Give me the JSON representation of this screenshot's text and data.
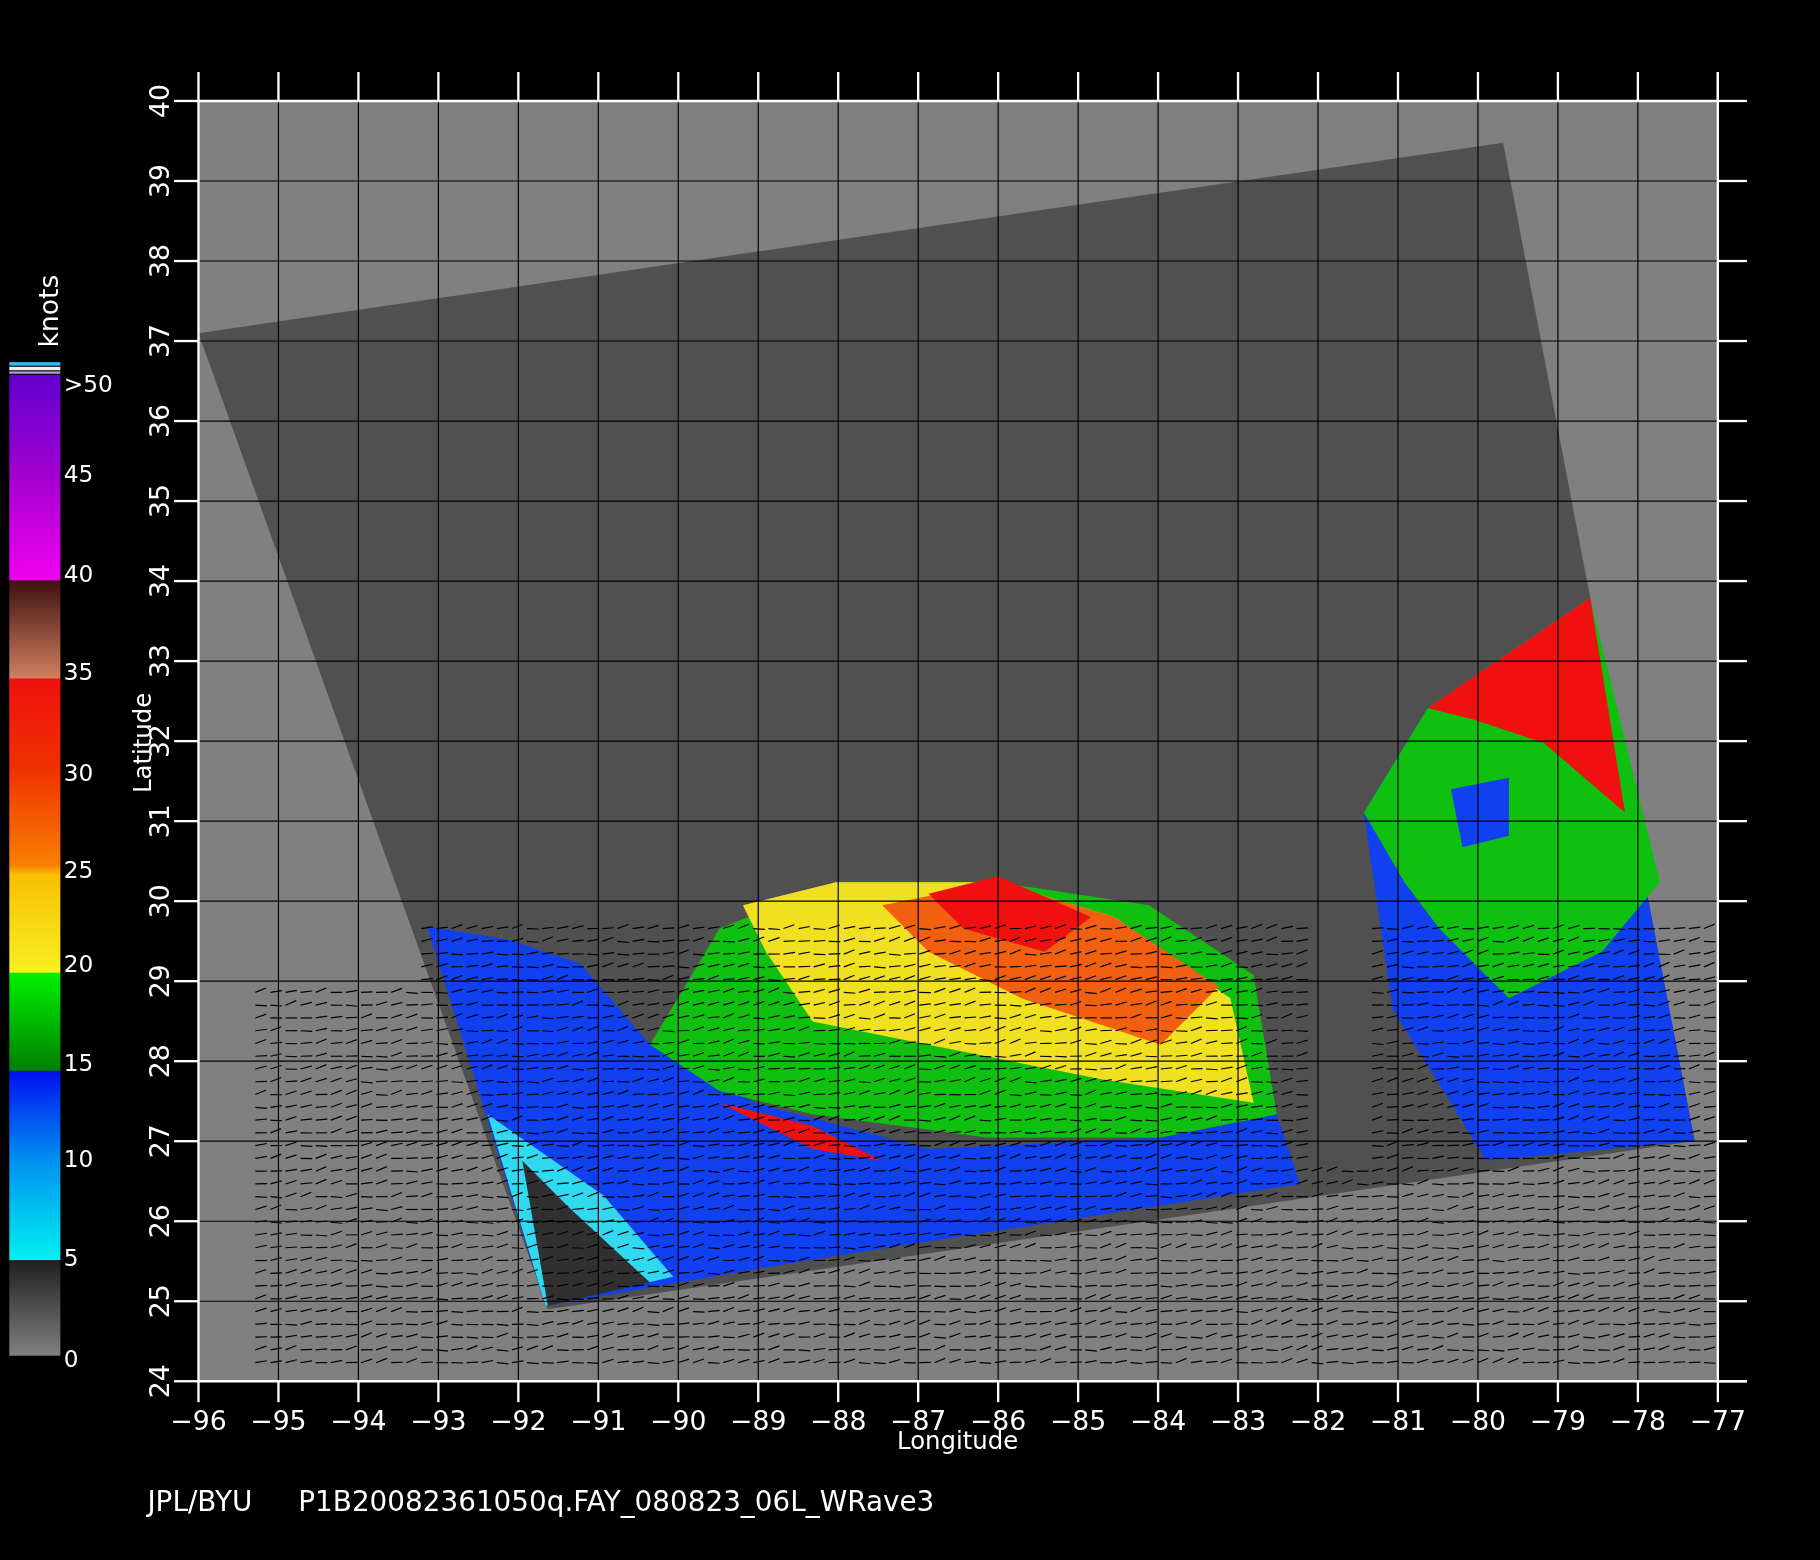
{
  "plot": {
    "x_axis": {
      "title": "Longitude",
      "ticks": [
        "−96",
        "−95",
        "−94",
        "−93",
        "−92",
        "−91",
        "−90",
        "−89",
        "−88",
        "−87",
        "−86",
        "−85",
        "−84",
        "−83",
        "−82",
        "−81",
        "−80",
        "−79",
        "−78",
        "−77"
      ]
    },
    "y_axis": {
      "title": "Latitude",
      "ticks": [
        "24",
        "25",
        "26",
        "27",
        "28",
        "29",
        "30",
        "31",
        "32",
        "33",
        "34",
        "35",
        "36",
        "37",
        "38",
        "39",
        "40"
      ]
    },
    "colorbar": {
      "title": "knots",
      "labels": [
        ">50",
        "45",
        "40",
        "35",
        "30",
        "25",
        "20",
        "15",
        "10",
        "5",
        "0"
      ]
    }
  },
  "caption": {
    "source": "JPL/BYU",
    "file": "P1B20082361050q.FAY_080823_06L_WRave3"
  }
}
